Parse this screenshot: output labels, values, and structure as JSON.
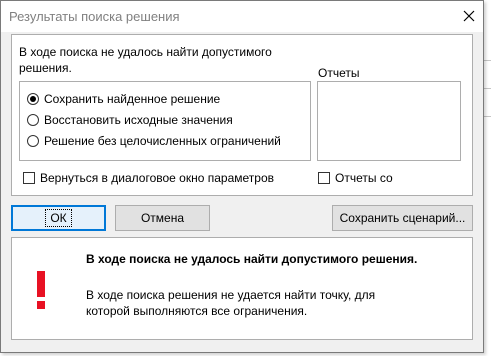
{
  "window": {
    "title": "Результаты поиска решения"
  },
  "panel": {
    "message": "В ходе поиска не удалось найти допустимого решения.",
    "options": [
      {
        "label": "Сохранить найденное решение",
        "mnemonic": "х",
        "checked": true
      },
      {
        "label": "Восстановить исходные значения",
        "mnemonic": "В",
        "checked": false
      },
      {
        "label": "Решение без целочисленных ограничений",
        "mnemonic": "ц",
        "checked": false
      }
    ],
    "reports_label": "Отчеты",
    "return_to_dialog": "Вернуться в диалоговое окно параметров",
    "reports_with_outline": "Отчеты со"
  },
  "buttons": {
    "ok": "ОК",
    "cancel": "Отмена",
    "save_scenario": "Сохранить сценарий..."
  },
  "message": {
    "heading": "В ходе поиска не удалось найти допустимого решения.",
    "body": "В ходе поиска решения не удается найти точку, для которой выполняются все ограничения."
  },
  "colors": {
    "accent": "#0078d7",
    "warning": "#e81123"
  },
  "icons": {
    "close": "close-icon",
    "warning": "exclamation-icon"
  }
}
